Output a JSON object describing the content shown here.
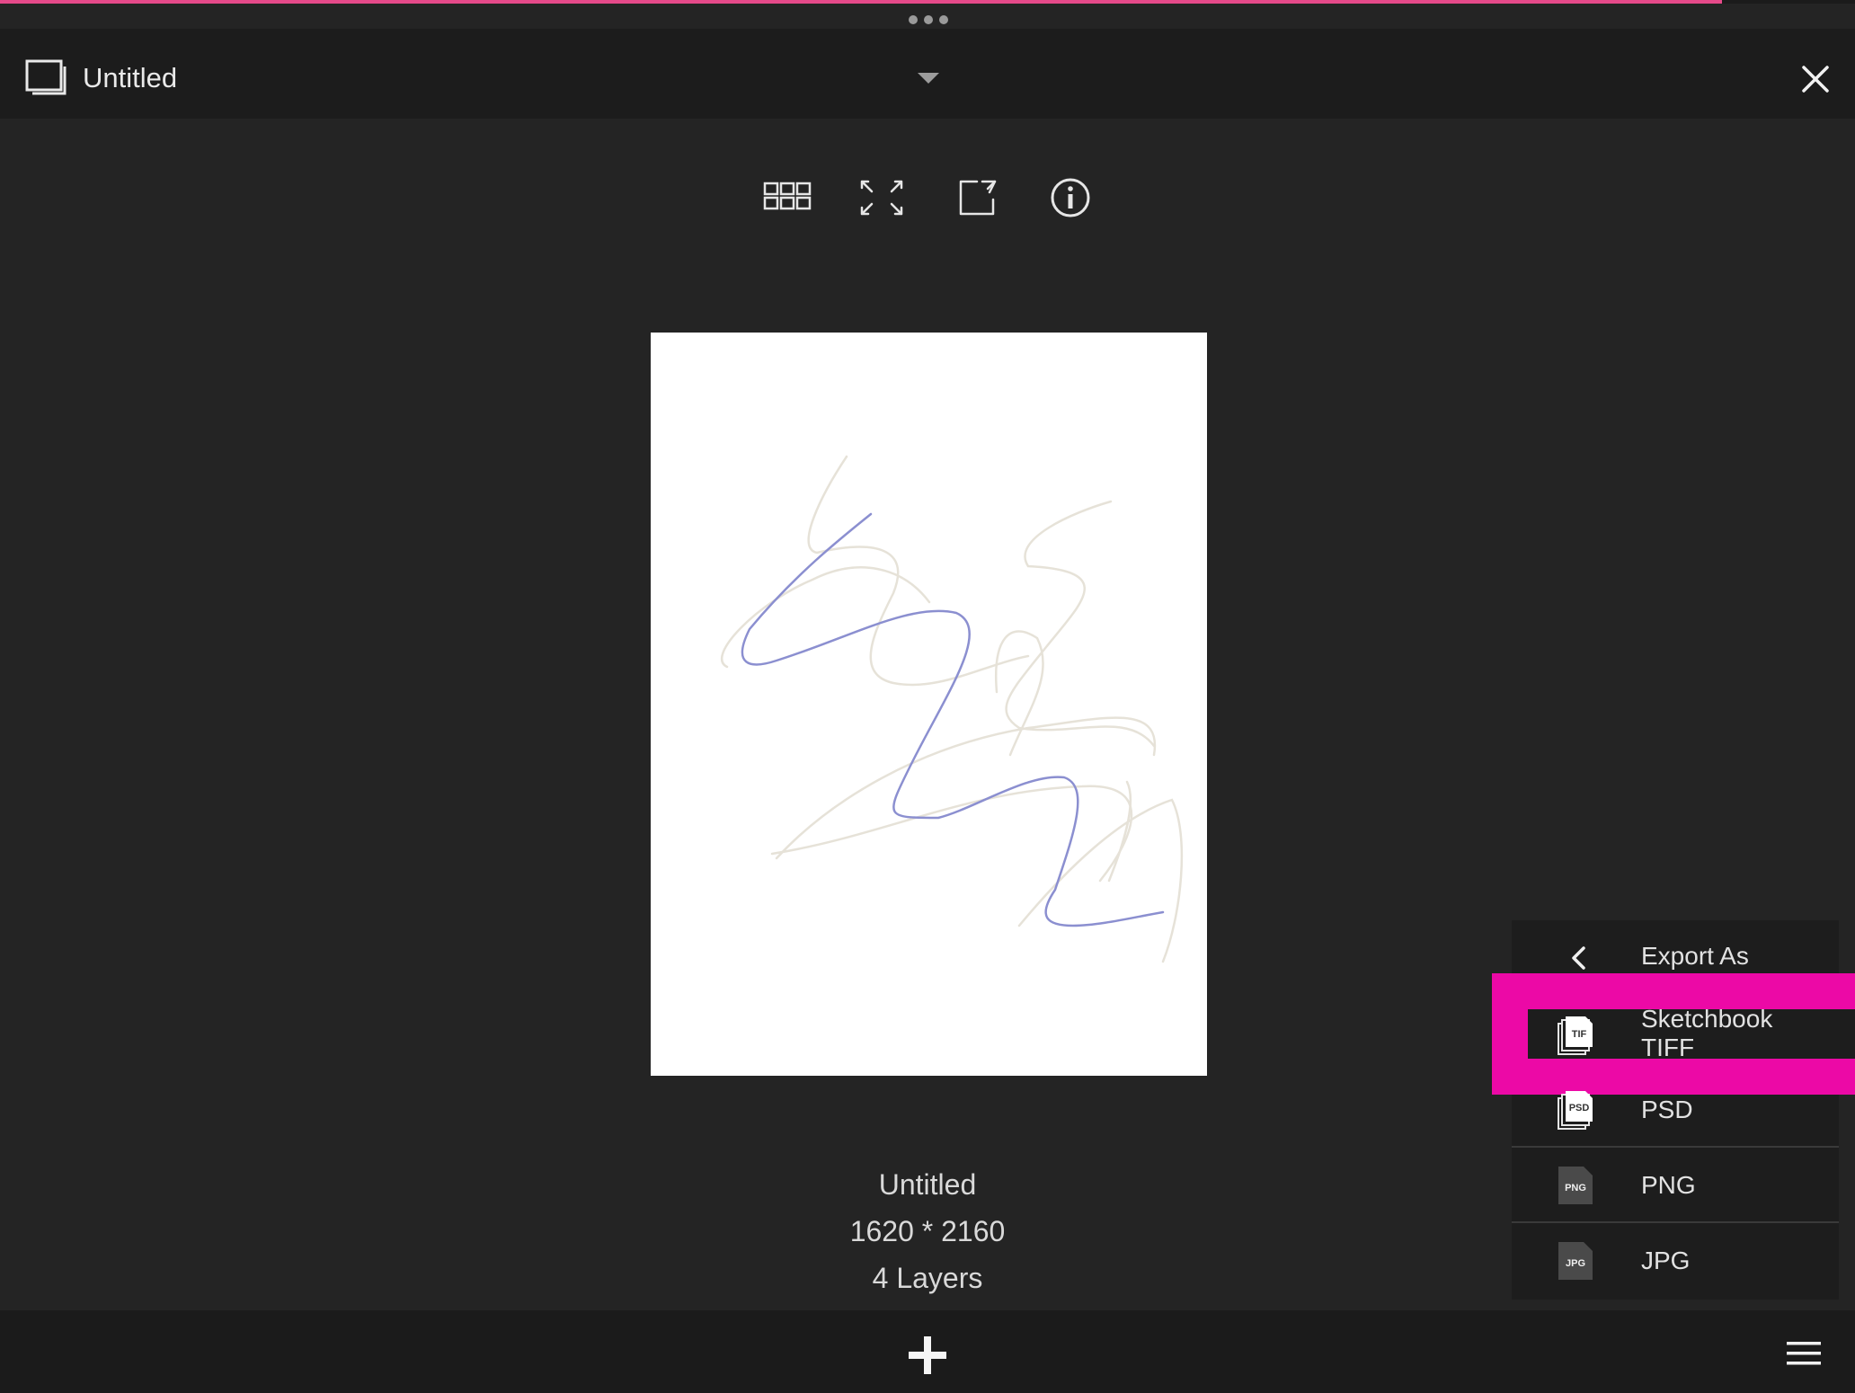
{
  "window": {
    "title": "Untitled"
  },
  "toolbar": {
    "icons": [
      "grid-icon",
      "fullscreen-icon",
      "export-icon",
      "info-icon"
    ]
  },
  "artwork": {
    "name": "Untitled",
    "dimensions": "1620 * 2160",
    "layers": "4 Layers"
  },
  "export_menu": {
    "header": "Export As",
    "items": [
      {
        "label_line1": "Sketchbook",
        "label_line2": "TIFF",
        "badge": "TIF"
      },
      {
        "label": "PSD",
        "badge": "PSD"
      },
      {
        "label": "PNG",
        "badge": "PNG"
      },
      {
        "label": "JPG",
        "badge": "JPG"
      }
    ]
  },
  "colors": {
    "background": "#242424",
    "highlight": "#ec09a6",
    "stroke_blue": "#8b8fd0",
    "stroke_beige": "#e6e2d8"
  }
}
